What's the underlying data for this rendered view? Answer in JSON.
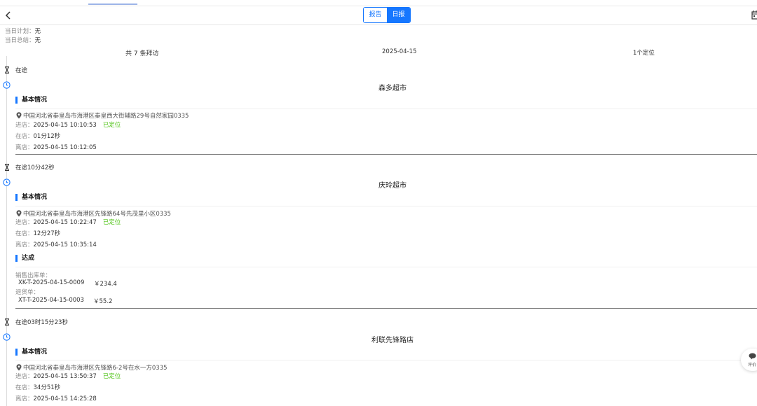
{
  "header": {
    "tabs": [
      {
        "label": "报告",
        "active": false
      },
      {
        "label": "日报",
        "active": true
      }
    ]
  },
  "plan": {
    "label": "当日计划：",
    "value": "无"
  },
  "summary_note": {
    "label": "当日总结：",
    "value": "无"
  },
  "overview": {
    "visit_count": "共 7 条拜访",
    "date": "2025-04-15",
    "locations": "1个定位"
  },
  "labels": {
    "basic": "基本情况",
    "enter": "进店：",
    "stay": "在店：",
    "leave": "离店：",
    "located": "已定位",
    "achieve": "达成",
    "sales_order": "销售出库单：",
    "return_order": "退货单："
  },
  "visits": [
    {
      "travel": "在途",
      "store": "森多超市",
      "address": "中国河北省秦皇岛市海港区秦皇西大街辅路29号自然家园0335",
      "enter_time": "2025-04-15 10:10:53",
      "stay": "01分12秒",
      "leave_time": "2025-04-15 10:12:05"
    },
    {
      "travel": "在途10分42秒",
      "store": "庆玲超市",
      "address": "中国河北省秦皇岛市海港区先锋路64号先茂里小区0335",
      "enter_time": "2025-04-15 10:22:47",
      "stay": "12分27秒",
      "leave_time": "2025-04-15 10:35:14",
      "orders": {
        "sales": {
          "no": "XK-T-2025-04-15-0009",
          "amount": "￥234.4"
        },
        "returns": {
          "no": "XT-T-2025-04-15-0003",
          "amount": "￥55.2"
        }
      }
    },
    {
      "travel": "在途03时15分23秒",
      "store": "利联先锋路店",
      "address": "中国河北省秦皇岛市海港区先锋路6-2号在水一方0335",
      "enter_time": "2025-04-15 13:50:37",
      "stay": "34分51秒",
      "leave_time": "2025-04-15 14:25:28"
    }
  ],
  "fab": {
    "label": "评价",
    "icon": "chat-icon"
  },
  "colors": {
    "accent": "#1677ff",
    "located": "#52c41a"
  }
}
